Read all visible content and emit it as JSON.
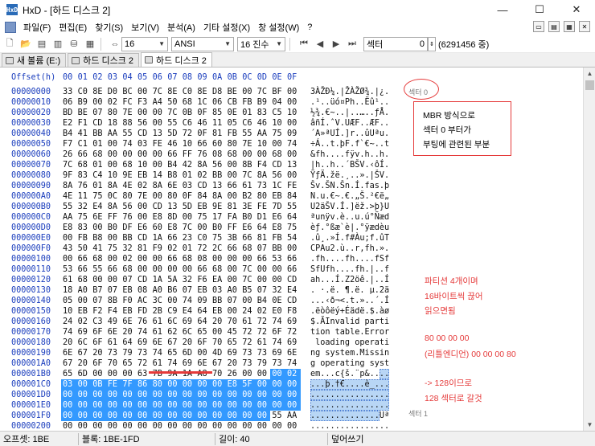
{
  "window": {
    "title": "HxD - [하드 디스크 2]",
    "app_icon": "HxD",
    "min": "—",
    "max": "☐",
    "close": "✕"
  },
  "menu": [
    "파일(F)",
    "편집(E)",
    "찾기(S)",
    "보기(V)",
    "분석(A)",
    "기타 설정(X)",
    "창 설정(W)",
    "?"
  ],
  "toolbar": {
    "bytes_per_row": "16",
    "charset": "ANSI",
    "base": "16 진수",
    "sector_label": "섹터",
    "sector_value": "0",
    "sector_total": "(6291456 중)"
  },
  "tabs": [
    "새 볼륨 (E:)",
    "하드 디스크 2",
    "하드 디스크 2"
  ],
  "header": {
    "offset_label": "Offset(h)",
    "columns": [
      "00",
      "01",
      "02",
      "03",
      "04",
      "05",
      "06",
      "07",
      "08",
      "09",
      "0A",
      "0B",
      "0C",
      "0D",
      "0E",
      "0F"
    ]
  },
  "rows": [
    {
      "off": "00000000",
      "hex": "33 C0 8E D0 BC 00 7C 8E C0 8E D8 BE 00 7C BF 00",
      "asc": "3ÀŽÐ¼.|ŽÀŽØ¾.|¿."
    },
    {
      "off": "00000010",
      "hex": "06 B9 00 02 FC F3 A4 50 68 1C 06 CB FB B9 04 00",
      "asc": ".¹..üó¤Ph..Ëû¹.."
    },
    {
      "off": "00000020",
      "hex": "BD BE 07 80 7E 00 00 7C 0B 0F 85 0E 01 83 C5 10",
      "asc": "½¾.€~..|..…..ƒÅ."
    },
    {
      "off": "00000030",
      "hex": "E2 F1 CD 18 88 56 00 55 C6 46 11 05 C6 46 10 00",
      "asc": "âñÍ.ˆV.UÆF..ÆF.."
    },
    {
      "off": "00000040",
      "hex": "B4 41 BB AA 55 CD 13 5D 72 0F 81 FB 55 AA 75 09",
      "asc": "´A»ªUÍ.]r..ûUªu."
    },
    {
      "off": "00000050",
      "hex": "F7 C1 01 00 74 03 FE 46 10 66 60 80 7E 10 00 74",
      "asc": "÷Á..t.þF.f`€~..t"
    },
    {
      "off": "00000060",
      "hex": "26 66 68 00 00 00 00 66 FF 76 08 68 00 00 68 00",
      "asc": "&fh....fÿv.h..h."
    },
    {
      "off": "00000070",
      "hex": "7C 68 01 00 68 10 00 B4 42 8A 56 00 8B F4 CD 13",
      "asc": "|h..h..´BŠV.‹ôÍ."
    },
    {
      "off": "00000080",
      "hex": "9F 83 C4 10 9E EB 14 B8 01 02 BB 00 7C 8A 56 00",
      "asc": "ŸƒÄ.žë.¸..».|ŠV."
    },
    {
      "off": "00000090",
      "hex": "8A 76 01 8A 4E 02 8A 6E 03 CD 13 66 61 73 1C FE",
      "asc": "Šv.ŠN.Šn.Í.fas.þ"
    },
    {
      "off": "000000A0",
      "hex": "4E 11 75 0C 80 7E 00 80 0F 84 8A 00 B2 80 EB 84",
      "asc": "N.u.€~.€.„Š.²€ë„"
    },
    {
      "off": "000000B0",
      "hex": "55 32 E4 8A 56 00 CD 13 5D EB 9E 81 3E FE 7D 55",
      "asc": "U2äŠV.Í.]ëž.>þ}U"
    },
    {
      "off": "000000C0",
      "hex": "AA 75 6E FF 76 00 E8 8D 00 75 17 FA B0 D1 E6 64",
      "asc": "ªunÿv.è..u.ú°Ñæd"
    },
    {
      "off": "000000D0",
      "hex": "E8 83 00 B0 DF E6 60 E8 7C 00 B0 FF E6 64 E8 75",
      "asc": "èƒ.°ßæ`è|.°ÿædèu"
    },
    {
      "off": "000000E0",
      "hex": "00 FB B8 00 BB CD 1A 66 23 C0 75 3B 66 81 FB 54",
      "asc": ".û¸.»Í.f#Àu;f.ûT"
    },
    {
      "off": "000000F0",
      "hex": "43 50 41 75 32 81 F9 02 01 72 2C 66 68 07 BB 00",
      "asc": "CPAu2.ù..r,fh.»."
    },
    {
      "off": "00000100",
      "hex": "00 66 68 00 02 00 00 66 68 08 00 00 00 66 53 66",
      "asc": ".fh....fh....fSf"
    },
    {
      "off": "00000110",
      "hex": "53 66 55 66 68 00 00 00 00 66 68 00 7C 00 00 66",
      "asc": "SfUfh....fh.|..f"
    },
    {
      "off": "00000120",
      "hex": "61 68 00 00 07 CD 1A 5A 32 F6 EA 00 7C 00 00 CD",
      "asc": "ah...Í.Z2öê.|..Í"
    },
    {
      "off": "00000130",
      "hex": "18 A0 B7 07 EB 08 A0 B6 07 EB 03 A0 B5 07 32 E4",
      "asc": ". ·.ë. ¶.ë. µ.2ä"
    },
    {
      "off": "00000140",
      "hex": "05 00 07 8B F0 AC 3C 00 74 09 BB 07 00 B4 0E CD",
      "asc": "...‹ð¬<.t.»..´.Í"
    },
    {
      "off": "00000150",
      "hex": "10 EB F2 F4 EB FD 2B C9 E4 64 EB 00 24 02 E0 F8",
      "asc": ".ëòôëý+Éädë.$.àø"
    },
    {
      "off": "00000160",
      "hex": "24 02 C3 49 6E 76 61 6C 69 64 20 70 61 72 74 69",
      "asc": "$.ÃInvalid parti"
    },
    {
      "off": "00000170",
      "hex": "74 69 6F 6E 20 74 61 62 6C 65 00 45 72 72 6F 72",
      "asc": "tion table.Error"
    },
    {
      "off": "00000180",
      "hex": "20 6C 6F 61 64 69 6E 67 20 6F 70 65 72 61 74 69",
      "asc": " loading operati"
    },
    {
      "off": "00000190",
      "hex": "6E 67 20 73 79 73 74 65 6D 00 4D 69 73 73 69 6E",
      "asc": "ng system.Missin"
    },
    {
      "off": "000001A0",
      "hex": "67 20 6F 70 65 72 61 74 69 6E 67 20 73 79 73 74",
      "asc": "g operating syst"
    },
    {
      "off": "000001B0",
      "hex": "65 6D 00 00 00 63 7B 9A 1A A8 70 26 00 00 00 02",
      "asc": "em...c{š.¨p&...."
    },
    {
      "off": "000001C0",
      "hex": "03 00 0B FE 7F 86 80 00 00 00 00 E8 5F 00 00 00",
      "asc": "...þ.†€....è_..."
    },
    {
      "off": "000001D0",
      "hex": "00 00 00 00 00 00 00 00 00 00 00 00 00 00 00 00",
      "asc": "................"
    },
    {
      "off": "000001E0",
      "hex": "00 00 00 00 00 00 00 00 00 00 00 00 00 00 00 00",
      "asc": "................"
    },
    {
      "off": "000001F0",
      "hex": "00 00 00 00 00 00 00 00 00 00 00 00 00 00 55 AA",
      "asc": "..............Uª"
    },
    {
      "off": "00000200",
      "hex": "00 00 00 00 00 00 00 00 00 00 00 00 00 00 00 00",
      "asc": "................"
    },
    {
      "off": "00000210",
      "hex": "00 00 00 00 00 00 00 00 00 00 00 00 00 00 00 00",
      "asc": "................"
    }
  ],
  "sector_markers": {
    "s0": "섹터 0",
    "s1": "섹터 1"
  },
  "annotations": {
    "box_lines": [
      "MBR 방식으로",
      "섹터 0 부터가",
      "부팅에 관련된 부분"
    ],
    "red_notes": [
      "파티션 4개이며",
      "16바이트씩 끊어",
      "읽으면됨",
      "80 00 00 00",
      "(리틀엔디언) 00 00 00 80",
      "-> 128이므로",
      "128 섹터로 갈것"
    ]
  },
  "status": {
    "offset": "오프셋: 1BE",
    "block": "블록: 1BE-1FD",
    "length": "길이: 40",
    "mode": "덮어쓰기"
  },
  "colors": {
    "offset_blue": "#1a3dbd",
    "selection": "#3399ff",
    "annotation_red": "#e53a3a"
  }
}
